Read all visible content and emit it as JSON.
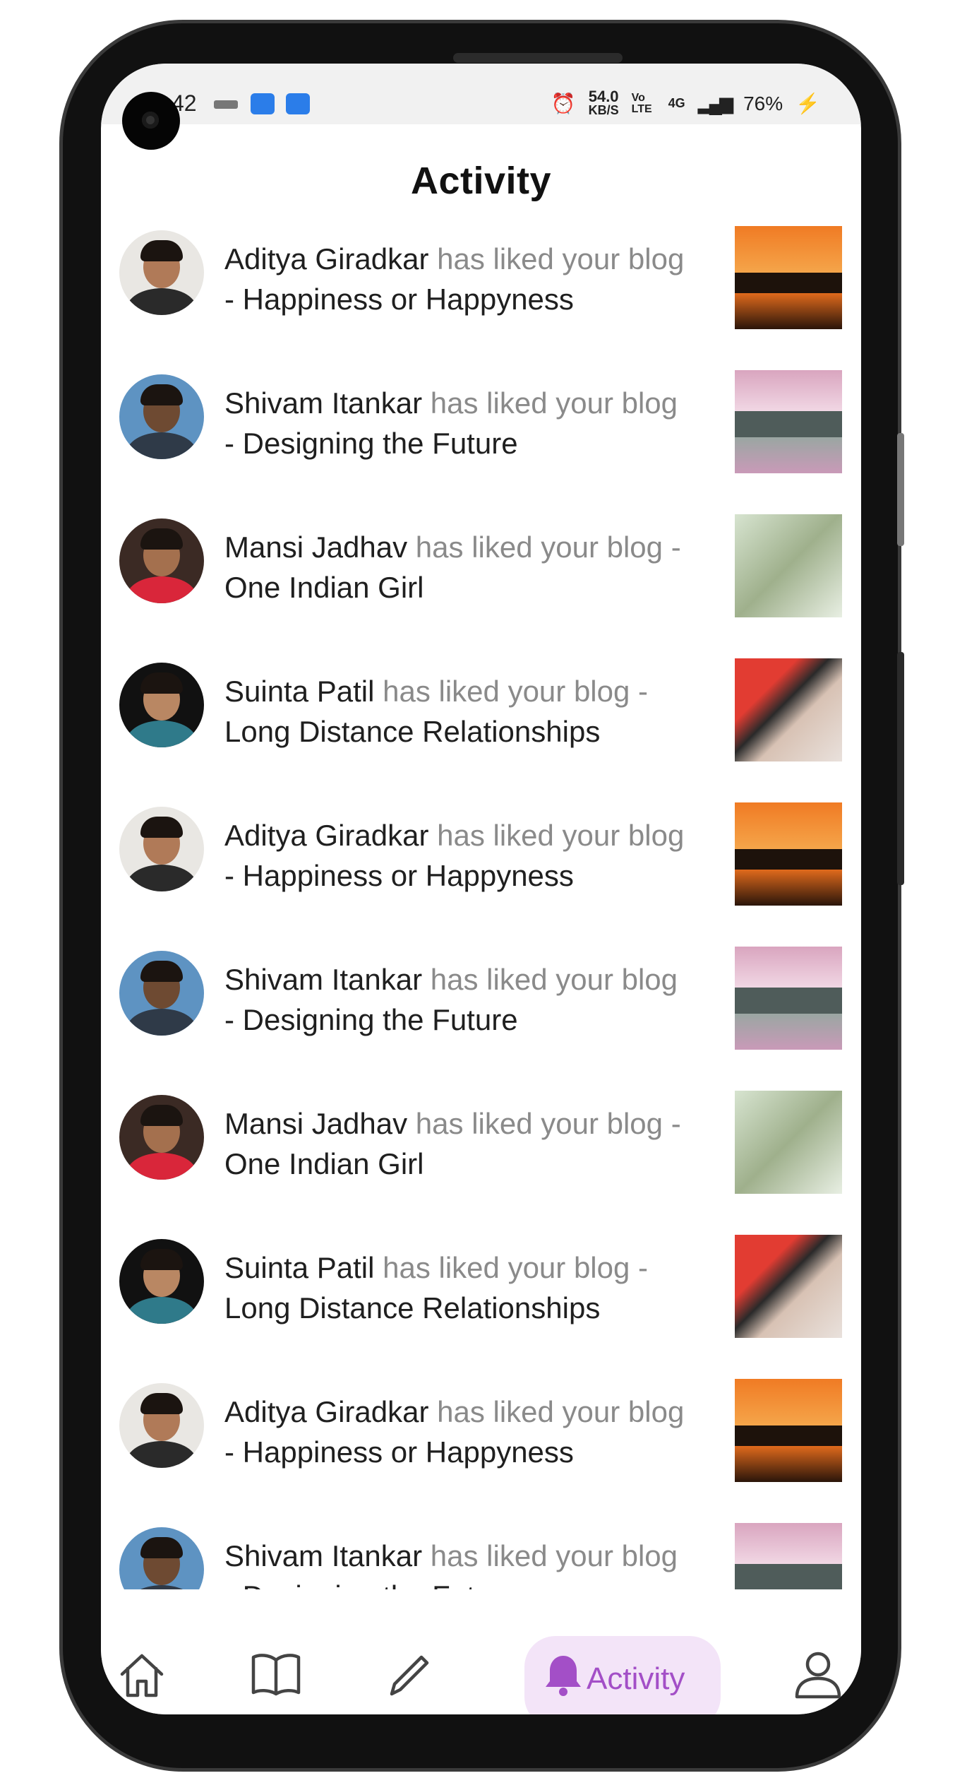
{
  "status_bar": {
    "time": "42",
    "network_speed_top": "54.0",
    "network_speed_unit": "KB/S",
    "volte": "Vo LTE",
    "network": "4G",
    "battery": "76%"
  },
  "header": {
    "title": "Activity"
  },
  "activity": [
    {
      "name": "Aditya Giradkar",
      "action": " has liked your blog",
      "blog": "- Happiness or Happyness",
      "avatar": "avatar-aditya",
      "thumb": "sunset"
    },
    {
      "name": "Shivam Itankar",
      "action": " has liked your blog",
      "blog": "- Designing the Future",
      "avatar": "avatar-shivam",
      "thumb": "building"
    },
    {
      "name": "Mansi Jadhav",
      "action": " has liked your blog -",
      "blog": "One Indian Girl",
      "avatar": "avatar-mansi",
      "thumb": "girl"
    },
    {
      "name": "Suinta Patil",
      "action": " has liked your blog -",
      "blog": "Long Distance Relationships",
      "avatar": "avatar-suinta",
      "thumb": "hands"
    },
    {
      "name": "Aditya Giradkar",
      "action": " has liked your blog",
      "blog": "- Happiness or Happyness",
      "avatar": "avatar-aditya",
      "thumb": "sunset"
    },
    {
      "name": "Shivam Itankar",
      "action": " has liked your blog",
      "blog": "- Designing the Future",
      "avatar": "avatar-shivam",
      "thumb": "building"
    },
    {
      "name": "Mansi Jadhav",
      "action": " has liked your blog -",
      "blog": "One Indian Girl",
      "avatar": "avatar-mansi",
      "thumb": "girl"
    },
    {
      "name": "Suinta Patil",
      "action": " has liked your blog -",
      "blog": "Long Distance Relationships",
      "avatar": "avatar-suinta",
      "thumb": "hands"
    },
    {
      "name": "Aditya Giradkar",
      "action": " has liked your blog",
      "blog": "- Happiness or Happyness",
      "avatar": "avatar-aditya",
      "thumb": "sunset"
    },
    {
      "name": "Shivam Itankar",
      "action": " has liked your blog",
      "blog": "- Designing the Future",
      "avatar": "avatar-shivam",
      "thumb": "building"
    }
  ],
  "bottom_nav": {
    "items": [
      {
        "icon": "home-icon"
      },
      {
        "icon": "book-icon"
      },
      {
        "icon": "pencil-icon"
      },
      {
        "icon": "bell-icon",
        "label": "Activity",
        "active": true
      },
      {
        "icon": "profile-icon"
      }
    ],
    "accent": "#a34fc7",
    "active_bg": "#f3e4f8"
  }
}
